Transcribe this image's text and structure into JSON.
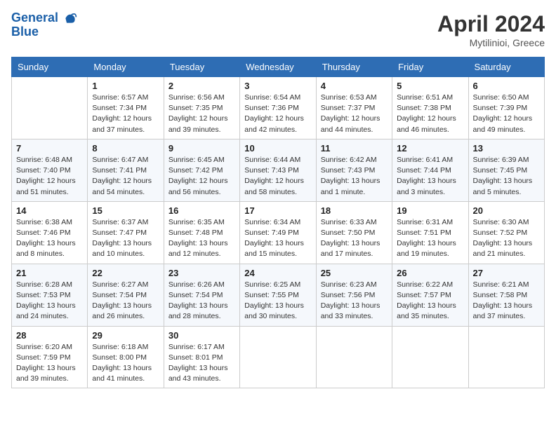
{
  "header": {
    "logo_line1": "General",
    "logo_line2": "Blue",
    "month": "April 2024",
    "location": "Mytilinioi, Greece"
  },
  "days_of_week": [
    "Sunday",
    "Monday",
    "Tuesday",
    "Wednesday",
    "Thursday",
    "Friday",
    "Saturday"
  ],
  "weeks": [
    [
      {
        "day": "",
        "sunrise": "",
        "sunset": "",
        "daylight": ""
      },
      {
        "day": "1",
        "sunrise": "Sunrise: 6:57 AM",
        "sunset": "Sunset: 7:34 PM",
        "daylight": "Daylight: 12 hours and 37 minutes."
      },
      {
        "day": "2",
        "sunrise": "Sunrise: 6:56 AM",
        "sunset": "Sunset: 7:35 PM",
        "daylight": "Daylight: 12 hours and 39 minutes."
      },
      {
        "day": "3",
        "sunrise": "Sunrise: 6:54 AM",
        "sunset": "Sunset: 7:36 PM",
        "daylight": "Daylight: 12 hours and 42 minutes."
      },
      {
        "day": "4",
        "sunrise": "Sunrise: 6:53 AM",
        "sunset": "Sunset: 7:37 PM",
        "daylight": "Daylight: 12 hours and 44 minutes."
      },
      {
        "day": "5",
        "sunrise": "Sunrise: 6:51 AM",
        "sunset": "Sunset: 7:38 PM",
        "daylight": "Daylight: 12 hours and 46 minutes."
      },
      {
        "day": "6",
        "sunrise": "Sunrise: 6:50 AM",
        "sunset": "Sunset: 7:39 PM",
        "daylight": "Daylight: 12 hours and 49 minutes."
      }
    ],
    [
      {
        "day": "7",
        "sunrise": "Sunrise: 6:48 AM",
        "sunset": "Sunset: 7:40 PM",
        "daylight": "Daylight: 12 hours and 51 minutes."
      },
      {
        "day": "8",
        "sunrise": "Sunrise: 6:47 AM",
        "sunset": "Sunset: 7:41 PM",
        "daylight": "Daylight: 12 hours and 54 minutes."
      },
      {
        "day": "9",
        "sunrise": "Sunrise: 6:45 AM",
        "sunset": "Sunset: 7:42 PM",
        "daylight": "Daylight: 12 hours and 56 minutes."
      },
      {
        "day": "10",
        "sunrise": "Sunrise: 6:44 AM",
        "sunset": "Sunset: 7:43 PM",
        "daylight": "Daylight: 12 hours and 58 minutes."
      },
      {
        "day": "11",
        "sunrise": "Sunrise: 6:42 AM",
        "sunset": "Sunset: 7:43 PM",
        "daylight": "Daylight: 13 hours and 1 minute."
      },
      {
        "day": "12",
        "sunrise": "Sunrise: 6:41 AM",
        "sunset": "Sunset: 7:44 PM",
        "daylight": "Daylight: 13 hours and 3 minutes."
      },
      {
        "day": "13",
        "sunrise": "Sunrise: 6:39 AM",
        "sunset": "Sunset: 7:45 PM",
        "daylight": "Daylight: 13 hours and 5 minutes."
      }
    ],
    [
      {
        "day": "14",
        "sunrise": "Sunrise: 6:38 AM",
        "sunset": "Sunset: 7:46 PM",
        "daylight": "Daylight: 13 hours and 8 minutes."
      },
      {
        "day": "15",
        "sunrise": "Sunrise: 6:37 AM",
        "sunset": "Sunset: 7:47 PM",
        "daylight": "Daylight: 13 hours and 10 minutes."
      },
      {
        "day": "16",
        "sunrise": "Sunrise: 6:35 AM",
        "sunset": "Sunset: 7:48 PM",
        "daylight": "Daylight: 13 hours and 12 minutes."
      },
      {
        "day": "17",
        "sunrise": "Sunrise: 6:34 AM",
        "sunset": "Sunset: 7:49 PM",
        "daylight": "Daylight: 13 hours and 15 minutes."
      },
      {
        "day": "18",
        "sunrise": "Sunrise: 6:33 AM",
        "sunset": "Sunset: 7:50 PM",
        "daylight": "Daylight: 13 hours and 17 minutes."
      },
      {
        "day": "19",
        "sunrise": "Sunrise: 6:31 AM",
        "sunset": "Sunset: 7:51 PM",
        "daylight": "Daylight: 13 hours and 19 minutes."
      },
      {
        "day": "20",
        "sunrise": "Sunrise: 6:30 AM",
        "sunset": "Sunset: 7:52 PM",
        "daylight": "Daylight: 13 hours and 21 minutes."
      }
    ],
    [
      {
        "day": "21",
        "sunrise": "Sunrise: 6:28 AM",
        "sunset": "Sunset: 7:53 PM",
        "daylight": "Daylight: 13 hours and 24 minutes."
      },
      {
        "day": "22",
        "sunrise": "Sunrise: 6:27 AM",
        "sunset": "Sunset: 7:54 PM",
        "daylight": "Daylight: 13 hours and 26 minutes."
      },
      {
        "day": "23",
        "sunrise": "Sunrise: 6:26 AM",
        "sunset": "Sunset: 7:54 PM",
        "daylight": "Daylight: 13 hours and 28 minutes."
      },
      {
        "day": "24",
        "sunrise": "Sunrise: 6:25 AM",
        "sunset": "Sunset: 7:55 PM",
        "daylight": "Daylight: 13 hours and 30 minutes."
      },
      {
        "day": "25",
        "sunrise": "Sunrise: 6:23 AM",
        "sunset": "Sunset: 7:56 PM",
        "daylight": "Daylight: 13 hours and 33 minutes."
      },
      {
        "day": "26",
        "sunrise": "Sunrise: 6:22 AM",
        "sunset": "Sunset: 7:57 PM",
        "daylight": "Daylight: 13 hours and 35 minutes."
      },
      {
        "day": "27",
        "sunrise": "Sunrise: 6:21 AM",
        "sunset": "Sunset: 7:58 PM",
        "daylight": "Daylight: 13 hours and 37 minutes."
      }
    ],
    [
      {
        "day": "28",
        "sunrise": "Sunrise: 6:20 AM",
        "sunset": "Sunset: 7:59 PM",
        "daylight": "Daylight: 13 hours and 39 minutes."
      },
      {
        "day": "29",
        "sunrise": "Sunrise: 6:18 AM",
        "sunset": "Sunset: 8:00 PM",
        "daylight": "Daylight: 13 hours and 41 minutes."
      },
      {
        "day": "30",
        "sunrise": "Sunrise: 6:17 AM",
        "sunset": "Sunset: 8:01 PM",
        "daylight": "Daylight: 13 hours and 43 minutes."
      },
      {
        "day": "",
        "sunrise": "",
        "sunset": "",
        "daylight": ""
      },
      {
        "day": "",
        "sunrise": "",
        "sunset": "",
        "daylight": ""
      },
      {
        "day": "",
        "sunrise": "",
        "sunset": "",
        "daylight": ""
      },
      {
        "day": "",
        "sunrise": "",
        "sunset": "",
        "daylight": ""
      }
    ]
  ]
}
